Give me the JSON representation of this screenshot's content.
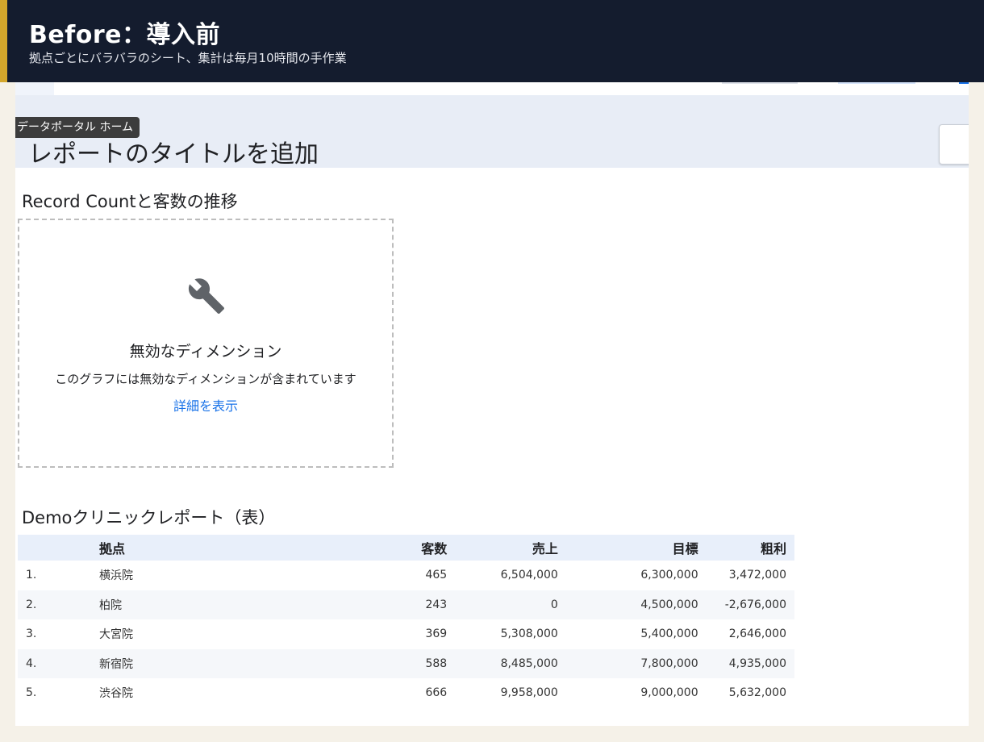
{
  "banner": {
    "title": "Before：導入前",
    "subtitle": "拠点ごとにバラバラのシート、集計は毎月10時間の手作業"
  },
  "tooltip": {
    "text": "データポータル ホーム"
  },
  "report": {
    "title": "レポートのタイトルを追加"
  },
  "chart_widget": {
    "title": "Record Countと客数の推移",
    "error_icon": "wrench-icon",
    "error_heading": "無効なディメンション",
    "error_description": "このグラフには無効なディメンションが含まれています",
    "details_link": "詳細を表示"
  },
  "table_widget": {
    "title": "Demoクリニックレポート（表）",
    "headers": {
      "rank": "",
      "site": "拠点",
      "customers": "客数",
      "sales": "売上",
      "target": "目標",
      "gross_profit": "粗利"
    },
    "rows": [
      {
        "rank": "1.",
        "site": "横浜院",
        "customers": "465",
        "sales": "6,504,000",
        "target": "6,300,000",
        "gross_profit": "3,472,000"
      },
      {
        "rank": "2.",
        "site": "柏院",
        "customers": "243",
        "sales": "0",
        "target": "4,500,000",
        "gross_profit": "-2,676,000"
      },
      {
        "rank": "3.",
        "site": "大宮院",
        "customers": "369",
        "sales": "5,308,000",
        "target": "5,400,000",
        "gross_profit": "2,646,000"
      },
      {
        "rank": "4.",
        "site": "新宿院",
        "customers": "588",
        "sales": "8,485,000",
        "target": "7,800,000",
        "gross_profit": "4,935,000"
      },
      {
        "rank": "5.",
        "site": "渋谷院",
        "customers": "666",
        "sales": "9,958,000",
        "target": "9,000,000",
        "gross_profit": "5,632,000"
      }
    ]
  },
  "colors": {
    "banner_bg": "#141c2e",
    "banner_accent": "#d4a72c",
    "header_band": "#e8edf6",
    "link": "#1a73e8",
    "table_header_bg": "#e8effa"
  }
}
